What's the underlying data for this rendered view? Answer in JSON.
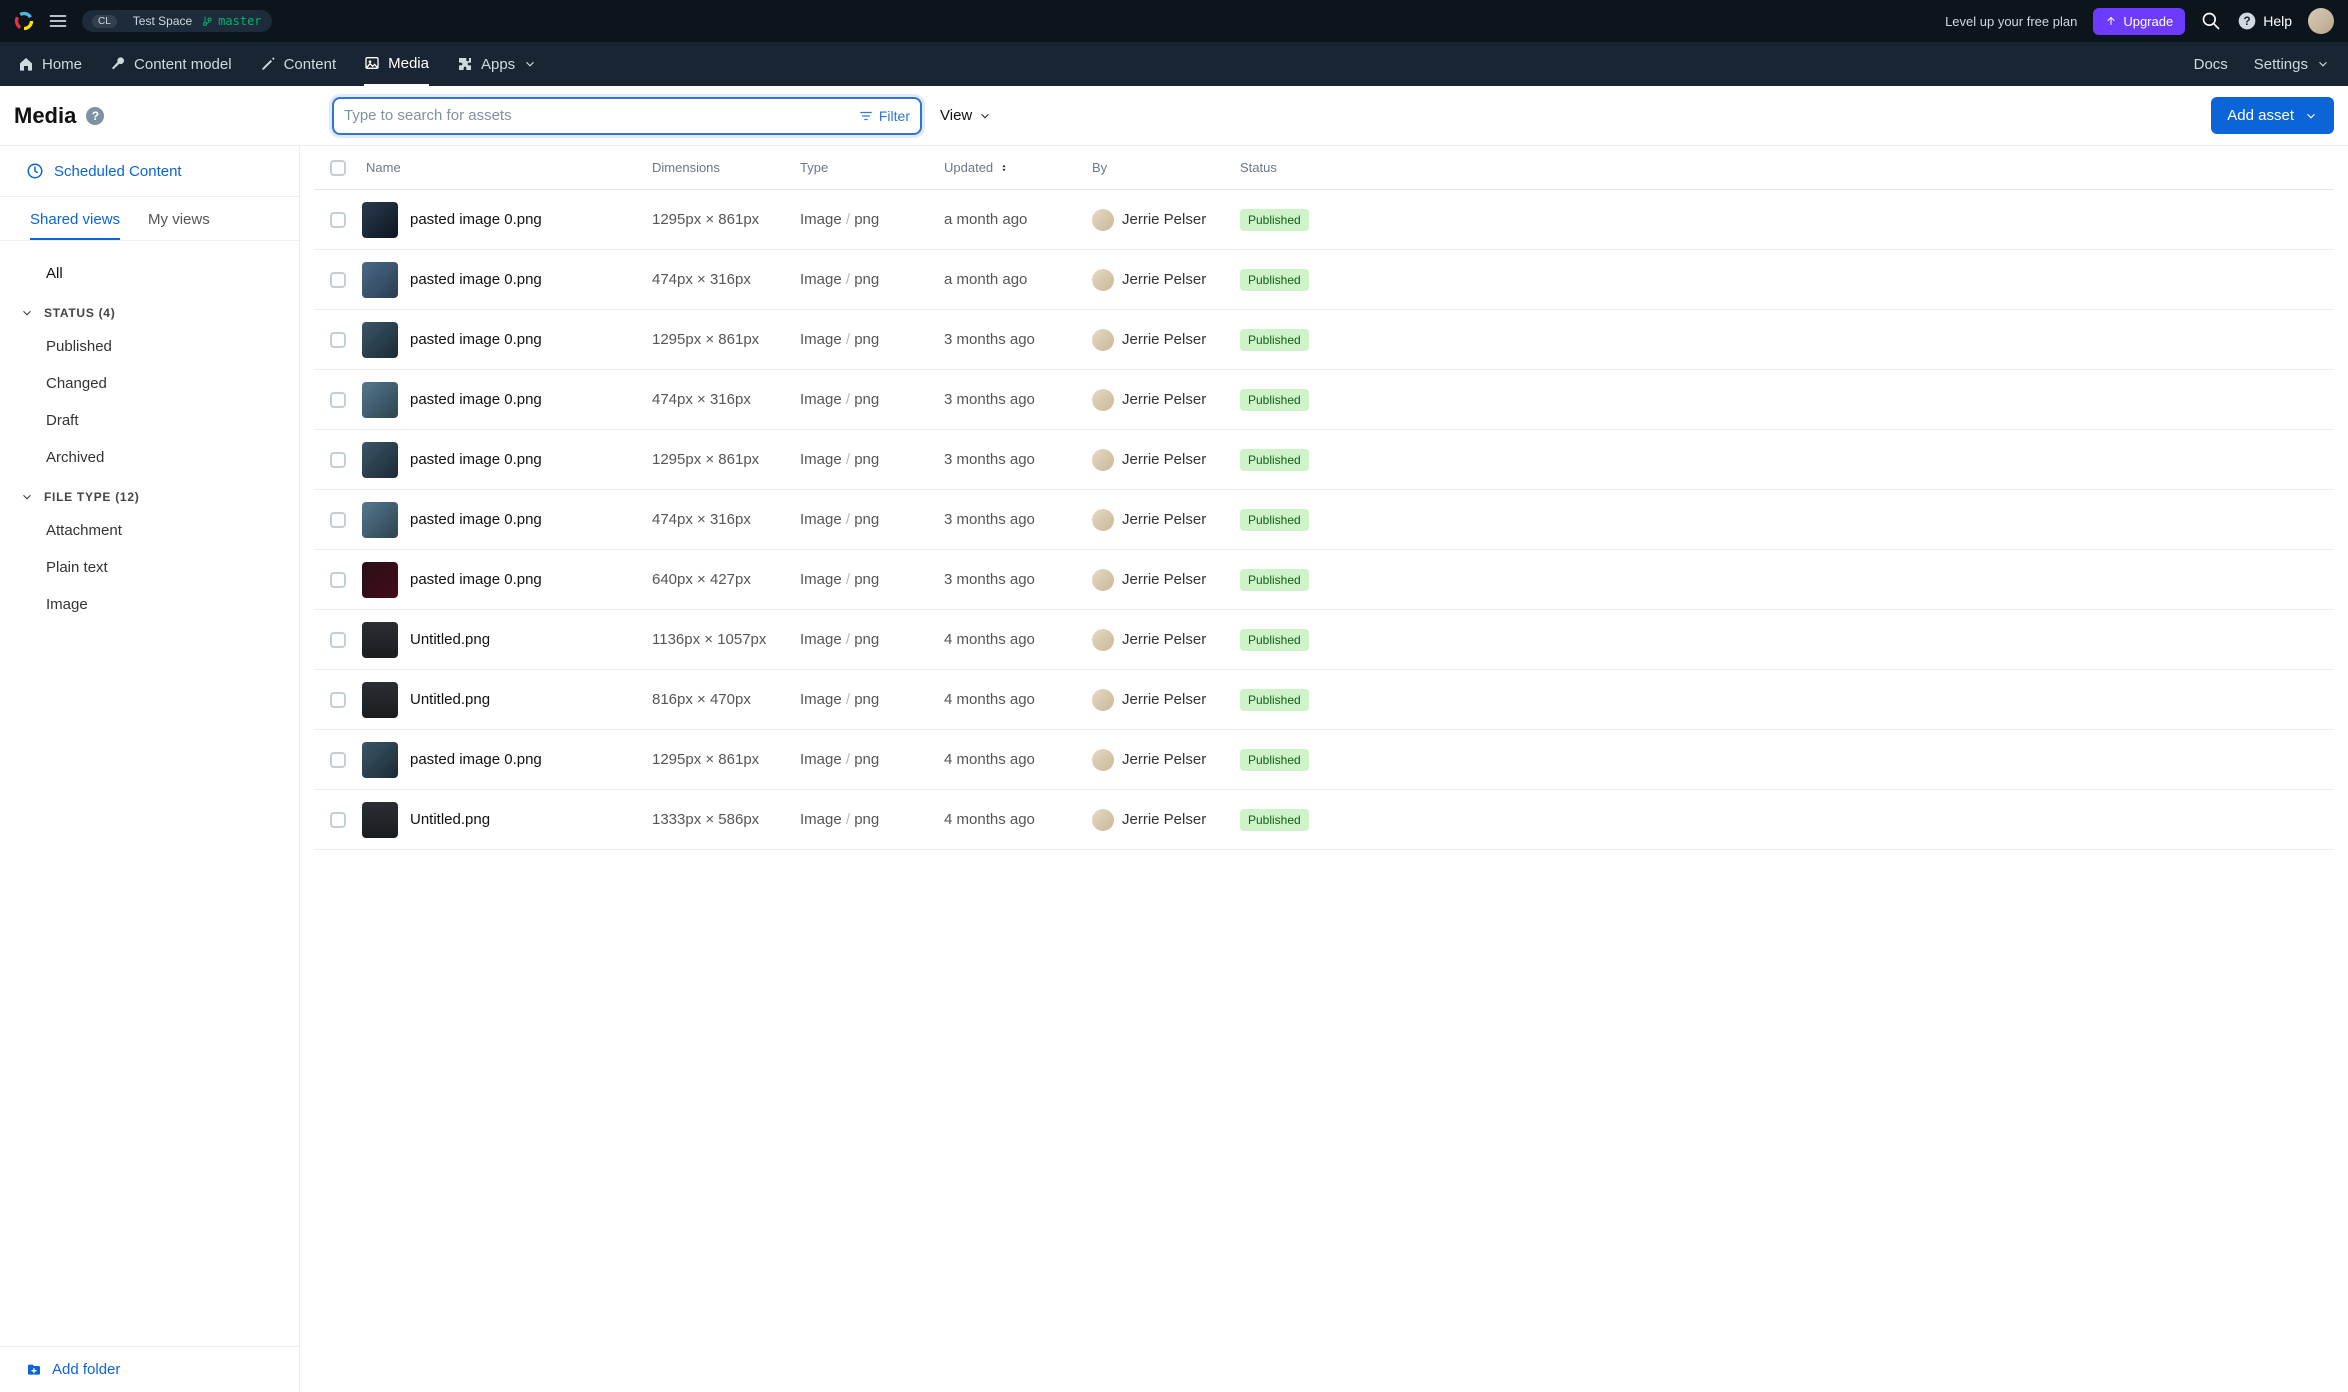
{
  "topbar": {
    "space_chip": "CL",
    "space_name": "Test Space",
    "branch": "master",
    "level_up": "Level up your free plan",
    "upgrade": "Upgrade",
    "help": "Help"
  },
  "nav": {
    "home": "Home",
    "content_model": "Content model",
    "content": "Content",
    "media": "Media",
    "apps": "Apps",
    "docs": "Docs",
    "settings": "Settings"
  },
  "toolbar": {
    "title": "Media",
    "search_placeholder": "Type to search for assets",
    "filter": "Filter",
    "view": "View",
    "add_asset": "Add asset"
  },
  "sidebar": {
    "scheduled": "Scheduled Content",
    "tabs": {
      "shared": "Shared views",
      "my": "My views"
    },
    "all": "All",
    "status_header": "STATUS (4)",
    "status_items": [
      "Published",
      "Changed",
      "Draft",
      "Archived"
    ],
    "filetype_header": "FILE TYPE (12)",
    "filetype_items": [
      "Attachment",
      "Plain text",
      "Image"
    ],
    "add_folder": "Add folder"
  },
  "table": {
    "headers": {
      "name": "Name",
      "dimensions": "Dimensions",
      "type": "Type",
      "updated": "Updated",
      "by": "By",
      "status": "Status"
    },
    "rows": [
      {
        "name": "pasted image 0.png",
        "dimensions": "1295px × 861px",
        "type_main": "Image",
        "type_sub": "png",
        "updated": "a month ago",
        "by": "Jerrie Pelser",
        "status": "Published",
        "thumb": "t1"
      },
      {
        "name": "pasted image 0.png",
        "dimensions": "474px × 316px",
        "type_main": "Image",
        "type_sub": "png",
        "updated": "a month ago",
        "by": "Jerrie Pelser",
        "status": "Published",
        "thumb": "t2"
      },
      {
        "name": "pasted image 0.png",
        "dimensions": "1295px × 861px",
        "type_main": "Image",
        "type_sub": "png",
        "updated": "3 months ago",
        "by": "Jerrie Pelser",
        "status": "Published",
        "thumb": "t3"
      },
      {
        "name": "pasted image 0.png",
        "dimensions": "474px × 316px",
        "type_main": "Image",
        "type_sub": "png",
        "updated": "3 months ago",
        "by": "Jerrie Pelser",
        "status": "Published",
        "thumb": "t4"
      },
      {
        "name": "pasted image 0.png",
        "dimensions": "1295px × 861px",
        "type_main": "Image",
        "type_sub": "png",
        "updated": "3 months ago",
        "by": "Jerrie Pelser",
        "status": "Published",
        "thumb": "t3"
      },
      {
        "name": "pasted image 0.png",
        "dimensions": "474px × 316px",
        "type_main": "Image",
        "type_sub": "png",
        "updated": "3 months ago",
        "by": "Jerrie Pelser",
        "status": "Published",
        "thumb": "t4"
      },
      {
        "name": "pasted image 0.png",
        "dimensions": "640px × 427px",
        "type_main": "Image",
        "type_sub": "png",
        "updated": "3 months ago",
        "by": "Jerrie Pelser",
        "status": "Published",
        "thumb": "t5"
      },
      {
        "name": "Untitled.png",
        "dimensions": "1136px × 1057px",
        "type_main": "Image",
        "type_sub": "png",
        "updated": "4 months ago",
        "by": "Jerrie Pelser",
        "status": "Published",
        "thumb": "t6"
      },
      {
        "name": "Untitled.png",
        "dimensions": "816px × 470px",
        "type_main": "Image",
        "type_sub": "png",
        "updated": "4 months ago",
        "by": "Jerrie Pelser",
        "status": "Published",
        "thumb": "t6"
      },
      {
        "name": "pasted image 0.png",
        "dimensions": "1295px × 861px",
        "type_main": "Image",
        "type_sub": "png",
        "updated": "4 months ago",
        "by": "Jerrie Pelser",
        "status": "Published",
        "thumb": "t3"
      },
      {
        "name": "Untitled.png",
        "dimensions": "1333px × 586px",
        "type_main": "Image",
        "type_sub": "png",
        "updated": "4 months ago",
        "by": "Jerrie Pelser",
        "status": "Published",
        "thumb": "t6"
      }
    ]
  }
}
